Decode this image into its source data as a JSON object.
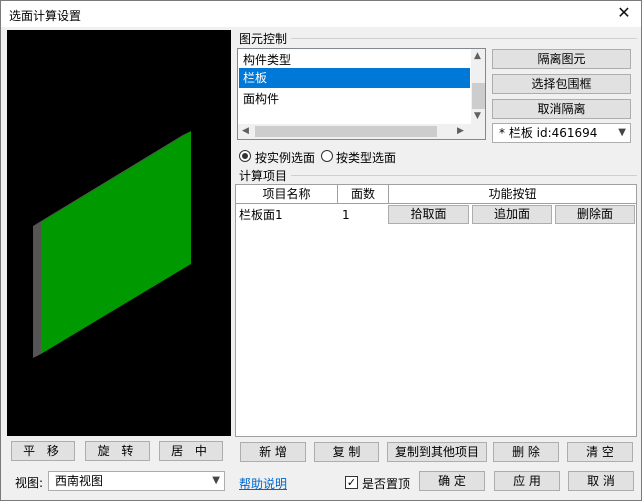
{
  "window": {
    "title": "选面计算设置",
    "close_icon": "✕"
  },
  "viewport": {
    "panel_color": "#009900",
    "edge_color": "#555555"
  },
  "element_control": {
    "label": "图元控制",
    "list": {
      "items": [
        "构件类型",
        "栏板",
        "面构件"
      ],
      "selected_index": 1
    },
    "isolate_label": "隔离图元",
    "select_box_label": "选择包围框",
    "cancel_isolate_label": "取消隔离",
    "element_select_value": "* 栏板 id:461694",
    "radio_instance_label": "按实例选面",
    "radio_type_label": "按类型选面",
    "selected_radio": "instance"
  },
  "calc_items": {
    "label": "计算项目",
    "columns": [
      "项目名称",
      "面数",
      "功能按钮"
    ],
    "rows": [
      {
        "name": "栏板面1",
        "faces": "1",
        "pick": "拾取面",
        "add": "追加面",
        "delete": "删除面"
      }
    ]
  },
  "view_buttons": {
    "pan": "平 移",
    "rotate": "旋 转",
    "center": "居 中"
  },
  "item_buttons": {
    "add": "新 增",
    "copy": "复 制",
    "copy_to": "复制到其他项目",
    "delete": "删 除",
    "clear": "清 空"
  },
  "footer": {
    "view_label": "视图:",
    "view_value": "西南视图",
    "help_link": "帮助说明",
    "ontop_label": "是否置顶",
    "ontop_checked": true,
    "ok": "确 定",
    "apply": "应 用",
    "cancel": "取 消"
  }
}
